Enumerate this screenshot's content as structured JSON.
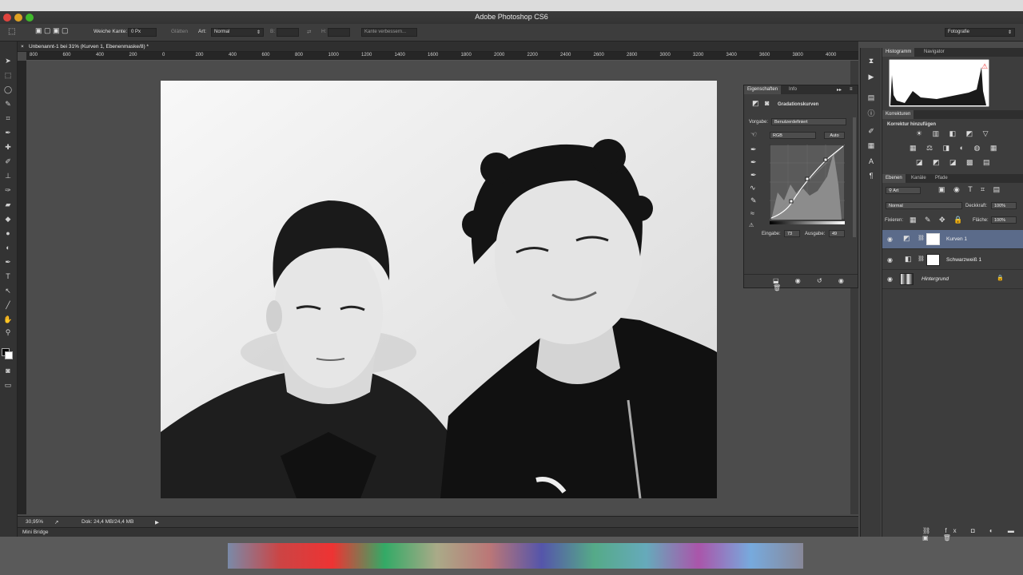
{
  "window": {
    "title": "Adobe Photoshop CS6"
  },
  "options_bar": {
    "soft_edge_label": "Weiche Kante:",
    "soft_edge_value": "0 Px",
    "smooth_label": "Glätten",
    "style_label": "Art:",
    "style_value": "Normal",
    "width_label": "B:",
    "height_label": "H:",
    "refine_edge_button": "Kante verbessern...",
    "workspace_value": "Fotografie"
  },
  "document": {
    "tab_title": "Unbenannt-1 bei 31% (Kurven 1, Ebenenmaske/8) *",
    "ruler_labels": [
      "800",
      "600",
      "400",
      "200",
      "0",
      "200",
      "400",
      "600",
      "800",
      "1000",
      "1200",
      "1400",
      "1600",
      "1800",
      "2000",
      "2200",
      "2400",
      "2600",
      "2800",
      "3000",
      "3200",
      "3400",
      "3600",
      "3800",
      "4000"
    ]
  },
  "status": {
    "zoom": "30,95%",
    "doc_info": "Dok: 24,4 MB/24,4 MB"
  },
  "mini_bridge": {
    "label": "Mini Bridge"
  },
  "histogram_panel": {
    "tabs": [
      "Histogramm",
      "Navigator"
    ]
  },
  "corrections_panel": {
    "tab": "Korrekturen",
    "subtitle": "Korrektur hinzufügen"
  },
  "properties_panel": {
    "tabs": [
      "Eigenschaften",
      "Info"
    ],
    "title": "Gradationskurven",
    "preset_label": "Vorgabe:",
    "preset_value": "Benutzerdefiniert",
    "channel_value": "RGB",
    "auto_button": "Auto",
    "input_label": "Eingabe:",
    "input_value": "73",
    "output_label": "Ausgabe:",
    "output_value": "49"
  },
  "layers_panel": {
    "tabs": [
      "Ebenen",
      "Kanäle",
      "Pfade"
    ],
    "filter_value": "Art",
    "blend_mode": "Normal",
    "opacity_label": "Deckkraft:",
    "opacity_value": "100%",
    "lock_label": "Fixieren:",
    "fill_label": "Fläche:",
    "fill_value": "100%",
    "layers": [
      {
        "name": "Kurven 1",
        "selected": true
      },
      {
        "name": "Schwarzweiß 1",
        "selected": false
      },
      {
        "name": "Hintergrund",
        "selected": false
      }
    ]
  }
}
